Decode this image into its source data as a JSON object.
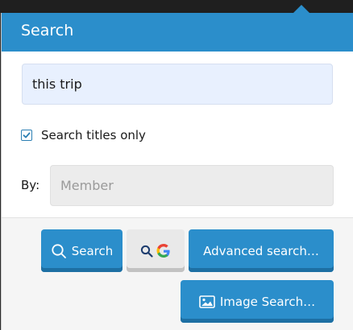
{
  "header": {
    "title": "Search"
  },
  "query": {
    "value": "this trip"
  },
  "options": {
    "titles_only_label": "Search titles only",
    "titles_only_checked": true
  },
  "by": {
    "label": "By:",
    "member_placeholder": "Member"
  },
  "buttons": {
    "search_label": "Search",
    "google_letter": "G",
    "advanced_label": "Advanced search…",
    "image_label": "Image Search…"
  },
  "colors": {
    "accent": "#2b8ecb",
    "input_bg": "#e8f0fe",
    "google_btn_bg": "#e9e9e9"
  }
}
